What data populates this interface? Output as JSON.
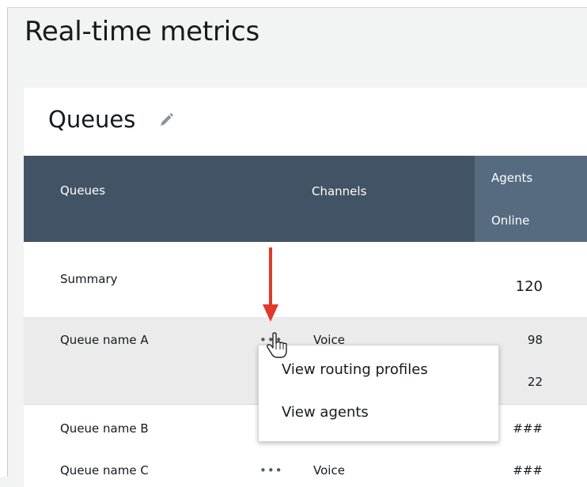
{
  "page": {
    "title": "Real-time metrics"
  },
  "panel": {
    "title": "Queues"
  },
  "table": {
    "headers": {
      "queues": "Queues",
      "channels": "Channels",
      "agents_line1": "Agents",
      "agents_line2": "Online"
    },
    "rows": [
      {
        "name": "Summary",
        "channel": "",
        "agents": "120"
      },
      {
        "name": "Queue name A",
        "channel": "Voice",
        "agents": "98",
        "agents_extra": "22",
        "more": "•••"
      },
      {
        "name": "Queue name B",
        "channel": "",
        "agents": "###",
        "more": ""
      },
      {
        "name": "Queue name C",
        "channel": "Voice",
        "agents": "###",
        "more": "•••"
      }
    ]
  },
  "context_menu": {
    "items": [
      {
        "label": "View routing profiles"
      },
      {
        "label": "View agents"
      }
    ]
  },
  "colors": {
    "header_bg": "#435366",
    "agents_header_bg": "#566b80",
    "arrow": "#e0392b",
    "selected_row": "#ebebeb"
  },
  "icons": {
    "edit": "pencil-icon",
    "more": "more-dots-icon",
    "arrow": "down-arrow-annotation",
    "cursor": "hand-pointer-cursor"
  }
}
